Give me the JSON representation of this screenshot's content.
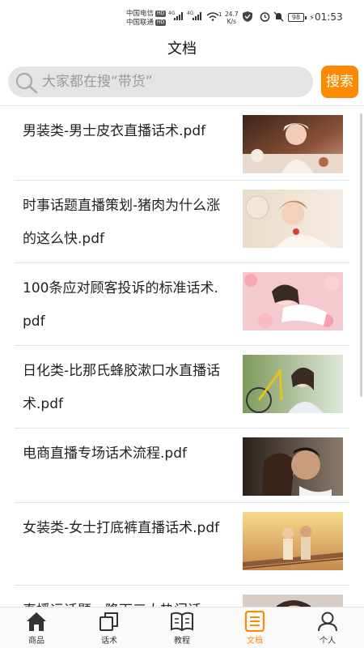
{
  "status_bar": {
    "carrier_1": "中国电信",
    "carrier_2": "中国联通",
    "hd_badge": "HD",
    "net_1": "4G",
    "net_2": "4G",
    "wifi_num": "1",
    "speed_value": "24.7",
    "speed_unit": "K/s",
    "battery": "98",
    "time": "01:53"
  },
  "header": {
    "title": "文档"
  },
  "search": {
    "placeholder": "大家都在搜“带货”",
    "button_label": "搜索"
  },
  "documents": [
    {
      "title": "男装类-男士皮衣直播话术.pdf",
      "thumb": "woman-cafe"
    },
    {
      "title": "时事话题直播策划-猪肉为什么涨的这么快.pdf",
      "thumb": "woman-bed"
    },
    {
      "title": "100条应对顾客投诉的标准话术.pdf",
      "thumb": "woman-flowers"
    },
    {
      "title": "日化类-比那氏蜂胶漱口水直播话术.pdf",
      "thumb": "woman-bicycle"
    },
    {
      "title": "电商直播专场话术流程.pdf",
      "thumb": "couple-closeup"
    },
    {
      "title": "女装类-女士打底裤直播话术.pdf",
      "thumb": "couple-railway"
    },
    {
      "title": "直播运话题—降下三大热门话",
      "thumb": "woman-partial"
    }
  ],
  "bottom_nav": [
    {
      "label": "商品",
      "icon": "home-icon",
      "active": false
    },
    {
      "label": "话术",
      "icon": "copy-icon",
      "active": false
    },
    {
      "label": "教程",
      "icon": "book-icon",
      "active": false
    },
    {
      "label": "文档",
      "icon": "document-icon",
      "active": true
    },
    {
      "label": "个人",
      "icon": "person-icon",
      "active": false
    }
  ],
  "colors": {
    "accent": "#ff8a00",
    "search_bg": "#e4e4e4",
    "divider": "#e2e2e2"
  }
}
